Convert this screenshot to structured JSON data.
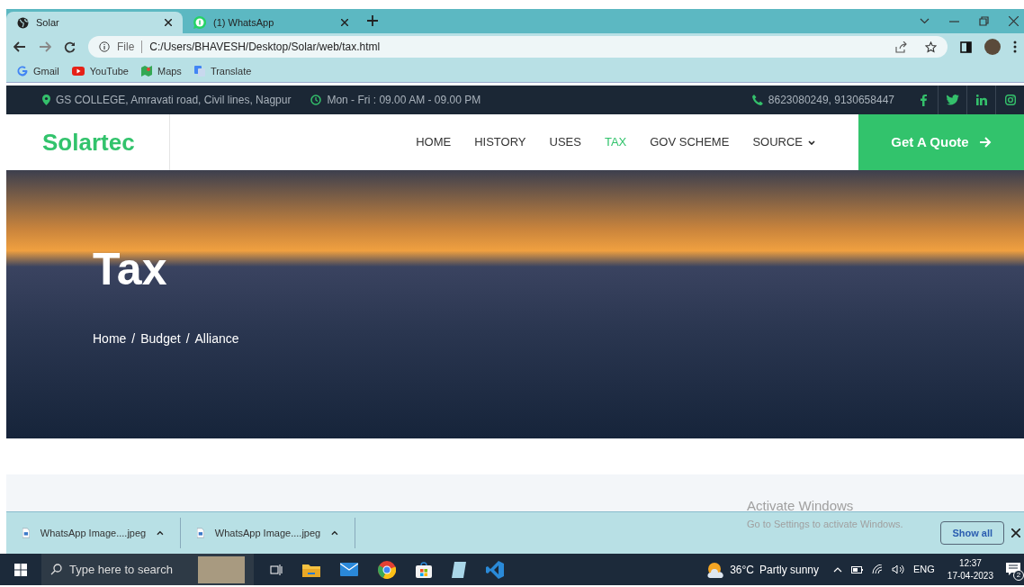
{
  "browser": {
    "tabs": [
      {
        "title": "Solar",
        "selected": true,
        "kind": "globe"
      },
      {
        "title": "(1) WhatsApp",
        "selected": false,
        "kind": "chat"
      }
    ],
    "address": {
      "scheme": "File",
      "url": "C:/Users/BHAVESH/Desktop/Solar/web/tax.html"
    },
    "bookmarks": [
      {
        "label": "Gmail",
        "kind": "google"
      },
      {
        "label": "YouTube",
        "kind": "youtube"
      },
      {
        "label": "Maps",
        "kind": "maps"
      },
      {
        "label": "Translate",
        "kind": "translate"
      }
    ]
  },
  "page": {
    "topbar": {
      "address": "GS COLLEGE, Amravati road, Civil lines, Nagpur",
      "hours": "Mon - Fri : 09.00 AM - 09.00 PM",
      "phone": "8623080249, 9130658447",
      "social": [
        {
          "kind": "facebook"
        },
        {
          "kind": "twitter"
        },
        {
          "kind": "linkedin"
        },
        {
          "kind": "instagram"
        }
      ]
    },
    "nav": {
      "logo": "Solartec",
      "items": [
        {
          "label": "HOME",
          "selected": false,
          "dropdown": false
        },
        {
          "label": "HISTORY",
          "selected": false,
          "dropdown": false
        },
        {
          "label": "USES",
          "selected": false,
          "dropdown": false
        },
        {
          "label": "TAX",
          "selected": true,
          "dropdown": false
        },
        {
          "label": "GOV SCHEME",
          "selected": false,
          "dropdown": false
        },
        {
          "label": "SOURCE",
          "selected": false,
          "dropdown": true
        }
      ],
      "cta": "Get A Quote"
    },
    "hero": {
      "title": "Tax",
      "breadcrumb": [
        "Home",
        "Budget",
        "Alliance"
      ],
      "separators": [
        "/",
        "/"
      ]
    }
  },
  "downloads": {
    "items": [
      "WhatsApp Image....jpeg",
      "WhatsApp Image....jpeg"
    ],
    "show_all": "Show all"
  },
  "activation": {
    "title": "Activate Windows",
    "subtitle": "Go to Settings to activate Windows."
  },
  "taskbar": {
    "search_placeholder": "Type here to search",
    "temperature": "36°C",
    "weather": "Partly sunny",
    "language": "ENG",
    "time": "12:37",
    "date": "17-04-2023",
    "notifications": "2"
  }
}
